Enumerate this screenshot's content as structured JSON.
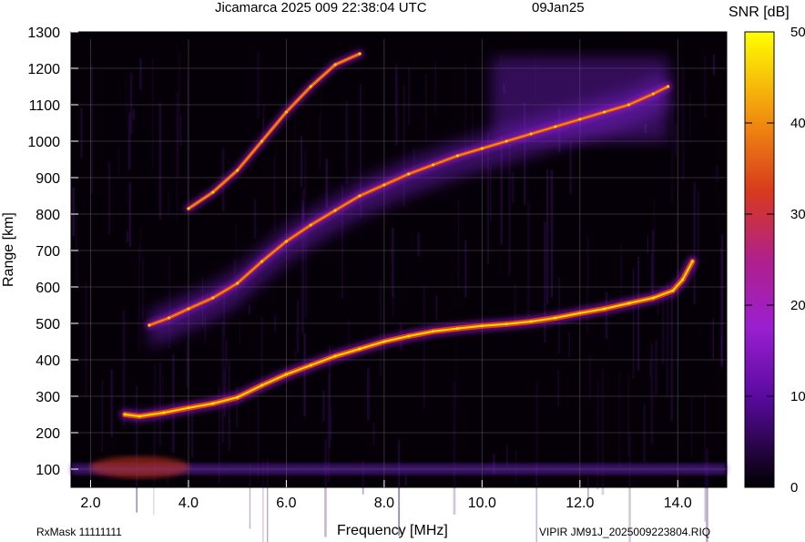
{
  "title": {
    "station_line": "Jicamarca 2025 009 22:38:04 UTC",
    "date": "09Jan25"
  },
  "footer": {
    "rxmask": "RxMask 11111111",
    "filename": "VIPIR  JM91J_2025009223804.RIQ"
  },
  "colors": {
    "background": "#000000",
    "grid": "#555555",
    "trace_core": "#ffee00",
    "trace_mid": "#e0401a",
    "trace_edge": "#9a1fd0"
  },
  "chart_data": {
    "type": "heatmap",
    "xlabel": "Frequency [MHz]",
    "ylabel": "Range [km]",
    "xlim": [
      1.6,
      15.0
    ],
    "ylim": [
      50,
      1300
    ],
    "x_ticks": [
      "2.0",
      "4.0",
      "6.0",
      "8.0",
      "10.0",
      "12.0",
      "14.0"
    ],
    "y_ticks": [
      "100",
      "200",
      "300",
      "400",
      "500",
      "600",
      "700",
      "800",
      "900",
      "1000",
      "1100",
      "1200",
      "1300"
    ],
    "colorbar": {
      "label": "SNR [dB]",
      "range": [
        0,
        50
      ],
      "ticks": [
        "0",
        "10",
        "20",
        "30",
        "40",
        "50"
      ],
      "colormap": "black-purple-red-orange-yellow"
    },
    "grid": true,
    "series": [
      {
        "x": [
          2.7,
          3.0,
          3.5,
          4.0,
          4.5,
          5.0,
          5.5,
          6.0,
          6.5,
          7.0,
          7.5,
          8.0,
          8.5,
          9.0,
          9.5,
          10.0,
          10.5,
          11.0,
          11.5,
          12.0,
          12.5,
          13.0,
          13.5,
          13.9,
          14.1,
          14.3
        ],
        "y": [
          250,
          245,
          255,
          268,
          280,
          297,
          330,
          360,
          385,
          410,
          430,
          450,
          465,
          478,
          486,
          493,
          498,
          505,
          515,
          528,
          540,
          555,
          570,
          590,
          620,
          670
        ]
      },
      {
        "x": [
          3.2,
          3.6,
          4.0,
          4.5,
          5.0,
          5.5,
          6.0,
          6.5,
          7.0,
          7.5,
          8.0,
          8.5,
          9.0,
          9.5,
          10.0,
          10.5,
          11.0,
          11.5,
          12.0,
          12.5,
          13.0,
          13.5,
          13.8
        ],
        "y": [
          495,
          515,
          540,
          570,
          610,
          670,
          725,
          770,
          810,
          850,
          880,
          910,
          935,
          960,
          980,
          1000,
          1020,
          1040,
          1060,
          1080,
          1100,
          1130,
          1150
        ]
      },
      {
        "x": [
          4.0,
          4.5,
          5.0,
          5.5,
          6.0,
          6.5,
          7.0,
          7.5
        ],
        "y": [
          815,
          860,
          920,
          1000,
          1080,
          1150,
          1210,
          1240
        ]
      }
    ]
  }
}
